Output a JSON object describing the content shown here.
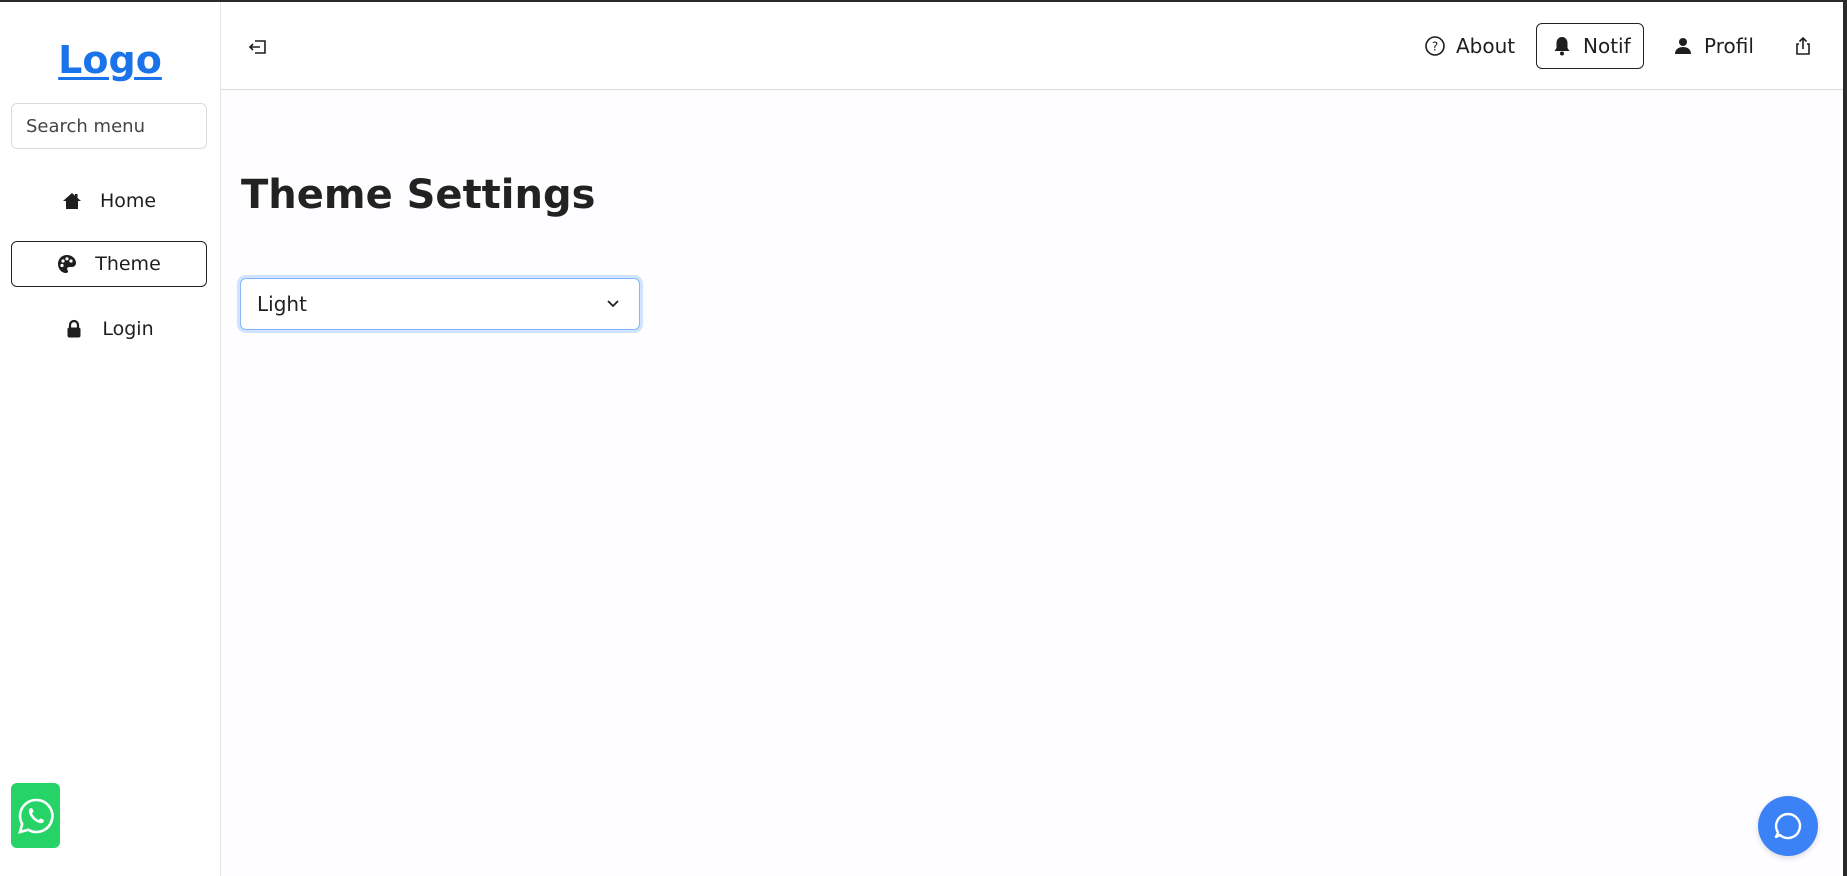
{
  "sidebar": {
    "logo": "Logo",
    "search_placeholder": "Search menu",
    "items": [
      {
        "label": "Home",
        "icon": "home-icon"
      },
      {
        "label": "Theme",
        "icon": "palette-icon",
        "active": true
      },
      {
        "label": "Login",
        "icon": "lock-icon"
      }
    ]
  },
  "header": {
    "about_label": "About",
    "notif_label": "Notif",
    "profil_label": "Profil"
  },
  "main": {
    "title": "Theme Settings",
    "theme_select": {
      "selected": "Light"
    }
  },
  "colors": {
    "accent": "#1a73e8",
    "whatsapp": "#25d366",
    "chat": "#3b82f6",
    "focus": "#86b7fe"
  }
}
